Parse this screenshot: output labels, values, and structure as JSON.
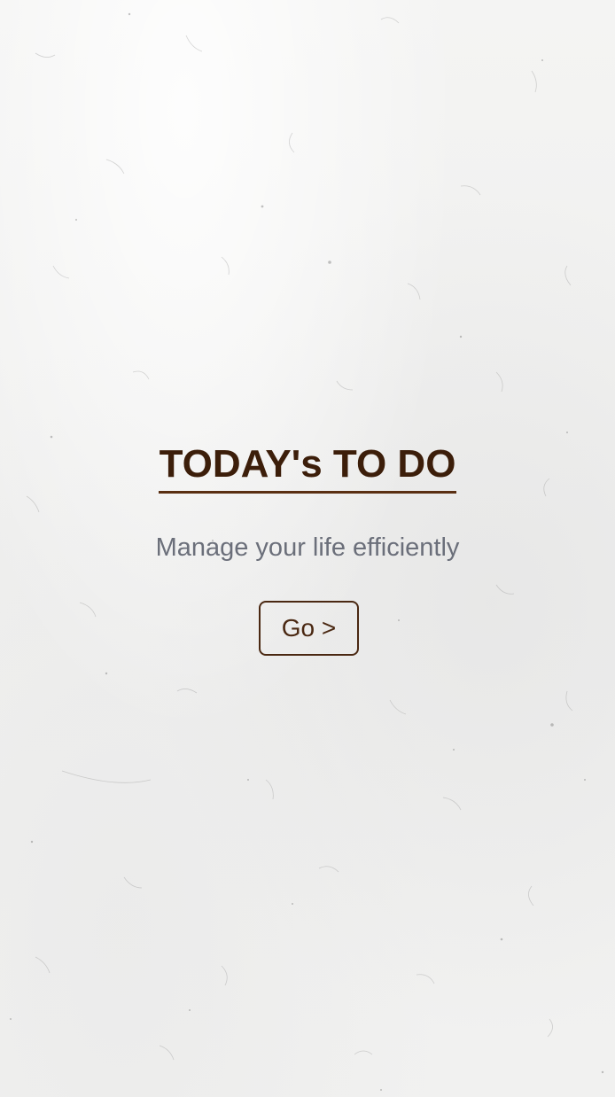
{
  "colors": {
    "title": "#3c1e0a",
    "title_underline": "#5a2f12",
    "subtitle": "#6b6f7a",
    "button_border": "#4a2812",
    "background": "#f2f2f1"
  },
  "landing": {
    "title": "TODAY's TO DO",
    "subtitle": "Manage your life efficiently",
    "go_button_label": "Go >"
  }
}
